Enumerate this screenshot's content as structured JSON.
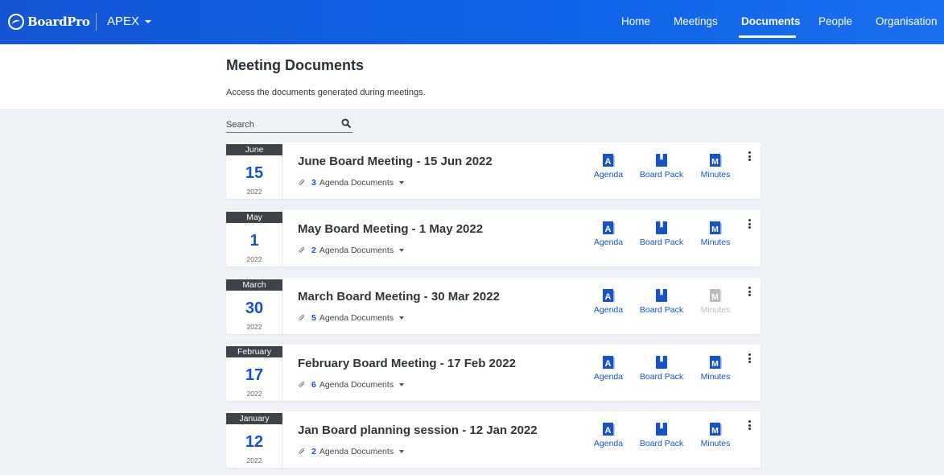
{
  "brand": {
    "name": "BoardPro",
    "org": "APEX"
  },
  "nav": [
    {
      "label": "Home",
      "active": false
    },
    {
      "label": "Meetings",
      "active": false
    },
    {
      "label": "Documents",
      "active": true
    },
    {
      "label": "People",
      "active": false
    },
    {
      "label": "Organisation",
      "active": false
    }
  ],
  "page": {
    "title": "Meeting Documents",
    "subtitle": "Access the documents generated during meetings."
  },
  "search": {
    "placeholder": "Search",
    "value": ""
  },
  "doc_labels": {
    "agenda": "Agenda",
    "board_pack": "Board Pack",
    "minutes": "Minutes",
    "agenda_docs_suffix": "Agenda Documents"
  },
  "meetings": [
    {
      "month": "June",
      "day": "15",
      "year": "2022",
      "title": "June Board Meeting - 15 Jun 2022",
      "agenda_doc_count": "3",
      "minutes_available": true
    },
    {
      "month": "May",
      "day": "1",
      "year": "2022",
      "title": "May Board Meeting - 1 May 2022",
      "agenda_doc_count": "2",
      "minutes_available": true
    },
    {
      "month": "March",
      "day": "30",
      "year": "2022",
      "title": "March Board Meeting - 30 Mar 2022",
      "agenda_doc_count": "5",
      "minutes_available": false
    },
    {
      "month": "February",
      "day": "17",
      "year": "2022",
      "title": "February Board Meeting - 17 Feb 2022",
      "agenda_doc_count": "6",
      "minutes_available": true
    },
    {
      "month": "January",
      "day": "12",
      "year": "2022",
      "title": "Jan Board planning session - 12 Jan 2022",
      "agenda_doc_count": "2",
      "minutes_available": true
    }
  ],
  "colors": {
    "accent": "#1553c7",
    "topbar": "#1456d6",
    "date_header": "#3d4349",
    "disabled": "#b8bcc1"
  },
  "icons": [
    "boardpro-logo-icon",
    "caret-down-icon",
    "search-icon",
    "paperclip-icon",
    "agenda-doc-icon",
    "board-pack-icon",
    "minutes-doc-icon",
    "more-vert-icon"
  ]
}
